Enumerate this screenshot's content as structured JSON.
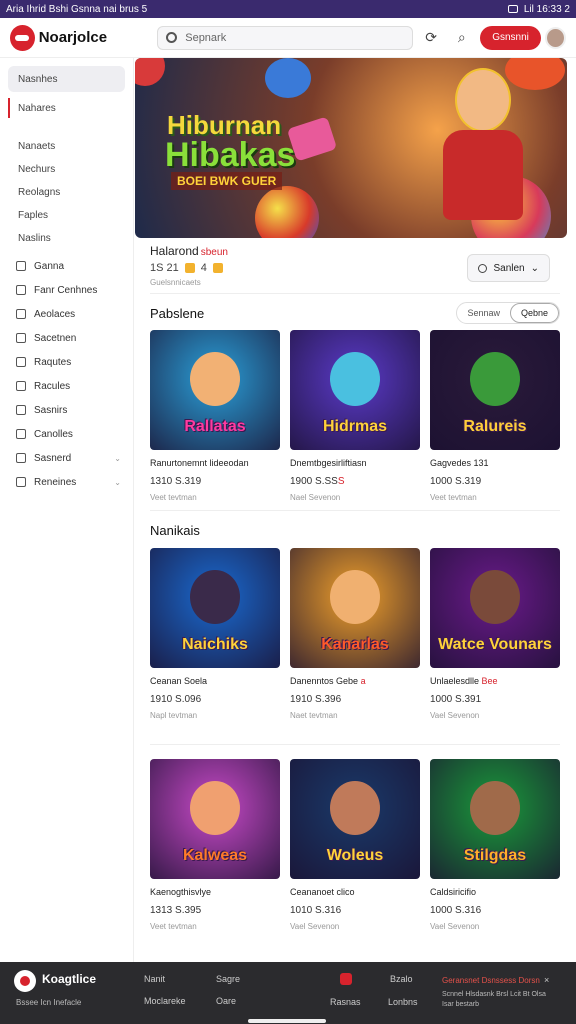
{
  "status_bar": {
    "left_text": "Aria Ihrid Bshi Gsnna nai brus 5",
    "right_text": "Lil 16:33 2"
  },
  "header": {
    "brand": "Noarjolce",
    "search_placeholder": "Sepnark",
    "cta_label": "Gsnsnni"
  },
  "sidebar": {
    "top_items": [
      {
        "label": "Nasnhes"
      },
      {
        "label": "Nahares"
      }
    ],
    "plain_items": [
      {
        "label": "Nanaets"
      },
      {
        "label": "Nechurs"
      },
      {
        "label": "Reolagns"
      },
      {
        "label": "Faples"
      },
      {
        "label": "Naslins"
      }
    ],
    "icon_items": [
      {
        "label": "Ganna",
        "chevron": ""
      },
      {
        "label": "Fanr Cenhnes",
        "chevron": ""
      },
      {
        "label": "Aeolaces",
        "chevron": ""
      },
      {
        "label": "Sacetnen",
        "chevron": ""
      },
      {
        "label": "Raqutes",
        "chevron": ""
      },
      {
        "label": "Racules",
        "chevron": ""
      },
      {
        "label": "Sasnirs",
        "chevron": ""
      },
      {
        "label": "Canolles",
        "chevron": ""
      },
      {
        "label": "Sasnerd",
        "chevron": "⌄"
      },
      {
        "label": "Reneines",
        "chevron": "⌄"
      }
    ]
  },
  "banner": {
    "title_line1": "Hiburnan",
    "title_line2": "Hibakas",
    "subtitle": "BOEI BWK GUER"
  },
  "meta": {
    "title": "Halarond",
    "title_tag": "sbeun",
    "stats_a": "1S 21",
    "stats_b": "4",
    "sub": "Guelsnnicaets",
    "sort_label": "Sanlen"
  },
  "sections": [
    {
      "title": "Pabslene",
      "seg_a": "Sennaw",
      "seg_b": "Qebne"
    },
    {
      "title": "Nanikais"
    }
  ],
  "cards": [
    {
      "title": "Rallatas",
      "name": "Ranurtonemnt lideeodan",
      "name_tag": "",
      "price": "1310 S.319",
      "price_tag": "",
      "sub": "Veet tevtman",
      "bg": "#2a9fd8",
      "face": "#f2b174",
      "title_color": "#ff3aa0"
    },
    {
      "title": "Hidrmas",
      "name": "Dnemtbgesirliftiasn",
      "name_tag": "",
      "price": "1900 S.SS",
      "price_tag": "S",
      "sub": "Nael Sevenon",
      "bg": "#5a3ac8",
      "face": "#4ac0e0",
      "title_color": "#ffd23a"
    },
    {
      "title": "Ralureis",
      "name": "Gagvedes 131",
      "name_tag": "",
      "price": "1000 S.319",
      "price_tag": "",
      "sub": "Veet tevtman",
      "bg": "#2a1a3a",
      "face": "#3a9a3a",
      "title_color": "#ffce3a"
    },
    {
      "title": "Naichiks",
      "name": "Ceanan Soela",
      "name_tag": "",
      "price": "1910 S.096",
      "price_tag": "",
      "sub": "Napl tevtman",
      "bg": "#1a6ad0",
      "face": "#3a2a4a",
      "title_color": "#ffd23a"
    },
    {
      "title": "Kanarlas",
      "name": "Danenntos Gebe",
      "name_tag": "a",
      "price": "1910 S.396",
      "price_tag": "",
      "sub": "Naet tevtman",
      "bg": "#f0a02a",
      "face": "#f0b070",
      "title_color": "#ff5a2a"
    },
    {
      "title": "Watce Vounars",
      "name": "Unlaelesdlle",
      "name_tag": "Bee",
      "price": "1000 S.391",
      "price_tag": "",
      "sub": "Vael Sevenon",
      "bg": "#6a1a8a",
      "face": "#7a4a3a",
      "title_color": "#ffd23a"
    },
    {
      "title": "Kalweas",
      "name": "Kaenogthisvlye",
      "name_tag": "",
      "price": "1313 S.395",
      "price_tag": "",
      "sub": "Veet tevtman",
      "bg": "#c84ac8",
      "face": "#f0a070",
      "title_color": "#ff7a2a"
    },
    {
      "title": "Woleus",
      "name": "Ceananoet clico",
      "name_tag": "",
      "price": "1010 S.316",
      "price_tag": "",
      "sub": "Vael Sevenon",
      "bg": "#1a3a6a",
      "face": "#c07a5a",
      "title_color": "#ffd23a"
    },
    {
      "title": "Stilgdas",
      "name": "Caldsiricifio",
      "name_tag": "",
      "price": "1000 S.316",
      "price_tag": "",
      "sub": "Vael Sevenon",
      "bg": "#1a9a3a",
      "face": "#a06a4a",
      "title_color": "#ffb02a"
    }
  ],
  "footer": {
    "brand": "Koagtlice",
    "sub": "Bssee Icn Inefacle",
    "col1_a": "Nanit",
    "col1_b": "Moclareke",
    "col2_a": "Sagre",
    "col2_b": "Oare",
    "col3_a": "Rasnas",
    "col4_a": "Bzalo",
    "col4_b": "Lonbns",
    "news_title": "Geransnet Dsnssess Dorsn",
    "news_sub": "Scnnel Hlsdasnk Brsl Lcit Bt Olsa Isar bestarb",
    "close": "×"
  }
}
